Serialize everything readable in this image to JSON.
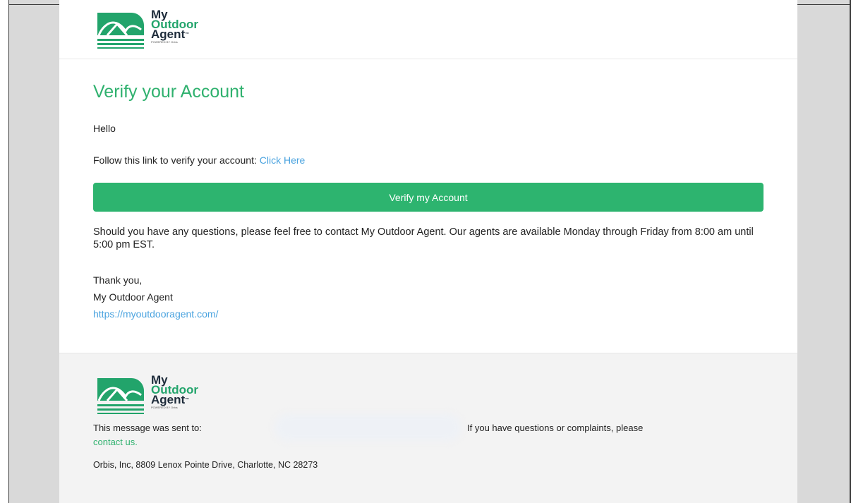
{
  "brand": {
    "line1": "My",
    "line2": "Outdoor",
    "line3": "Agent",
    "tm": "™",
    "powered": "POWERED BY Orbis",
    "green": "#2db46f",
    "dark": "#1d2b3a"
  },
  "email": {
    "title": "Verify your Account",
    "greeting": "Hello",
    "follow_text": "Follow this link to verify your account: ",
    "follow_link": "Click Here",
    "button_label": "Verify my Account",
    "questions": "Should you have any questions, please feel free to contact My Outdoor Agent. Our agents are available Monday through Friday from 8:00 am until 5:00 pm EST.",
    "thanks": "Thank you,",
    "signer": "My Outdoor Agent",
    "site_link": "https://myoutdooragent.com/"
  },
  "footer": {
    "sent_to": "This message was sent to:",
    "questions": "If you have questions or complaints, please",
    "contact_link": "contact us.",
    "address": "Orbis, Inc, 8809 Lenox Pointe Drive, Charlotte, NC 28273"
  }
}
